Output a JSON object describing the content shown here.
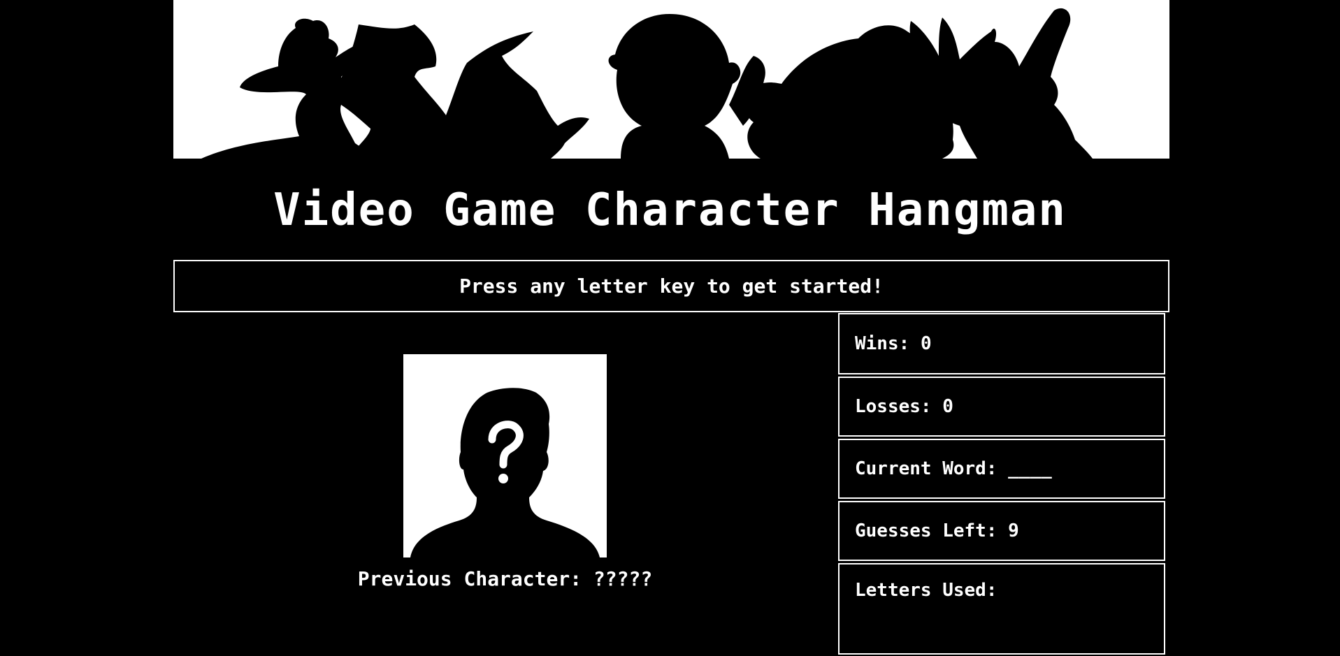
{
  "title": "Video Game Character Hangman",
  "prompt": "Press any letter key to get started!",
  "previous_character": {
    "label": "Previous Character:",
    "value": "?????"
  },
  "stats": {
    "wins": {
      "label": "Wins:",
      "value": "0"
    },
    "losses": {
      "label": "Losses:",
      "value": "0"
    },
    "current_word": {
      "label": "Current Word:",
      "value": "____"
    },
    "guesses_left": {
      "label": "Guesses Left:",
      "value": "9"
    },
    "letters_used": {
      "label": "Letters Used:",
      "value": ""
    }
  },
  "colors": {
    "background": "#000000",
    "foreground": "#ffffff"
  },
  "icons": {
    "banner": "character-silhouettes-banner",
    "portrait": "unknown-person-silhouette-icon"
  }
}
